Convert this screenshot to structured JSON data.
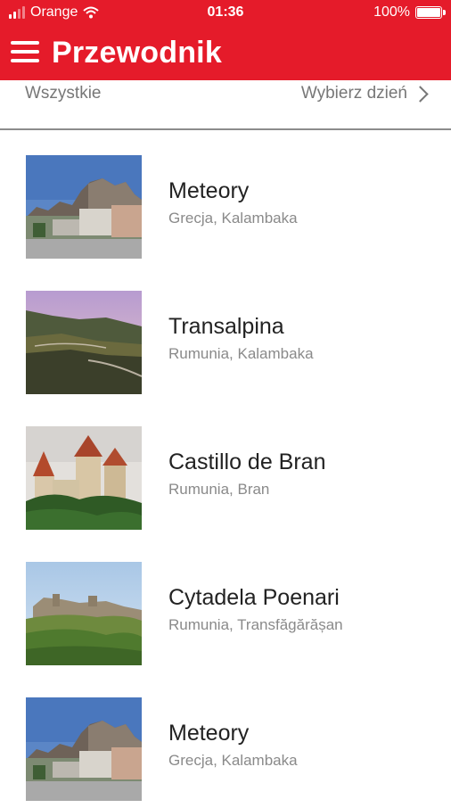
{
  "status_bar": {
    "carrier": "Orange",
    "time": "01:36",
    "battery": "100%",
    "battery_level": 1.0
  },
  "app_bar": {
    "title": "Przewodnik",
    "menu_icon": "hamburger-menu-icon"
  },
  "filter": {
    "all_label": "Wszystkie",
    "day_label": "Wybierz dzień",
    "day_icon": "chevron-right-icon"
  },
  "items": [
    {
      "title": "Meteory",
      "subtitle": "Grecja, Kalambaka",
      "image": "meteora-town"
    },
    {
      "title": "Transalpina",
      "subtitle": "Rumunia, Kalambaka",
      "image": "mountain-road"
    },
    {
      "title": "Castillo de Bran",
      "subtitle": "Rumunia, Bran",
      "image": "bran-castle"
    },
    {
      "title": "Cytadela Poenari",
      "subtitle": "Rumunia, Transfăgărășan",
      "image": "poenari-citadel"
    },
    {
      "title": "Meteory",
      "subtitle": "Grecja, Kalambaka",
      "image": "meteora-town"
    }
  ]
}
